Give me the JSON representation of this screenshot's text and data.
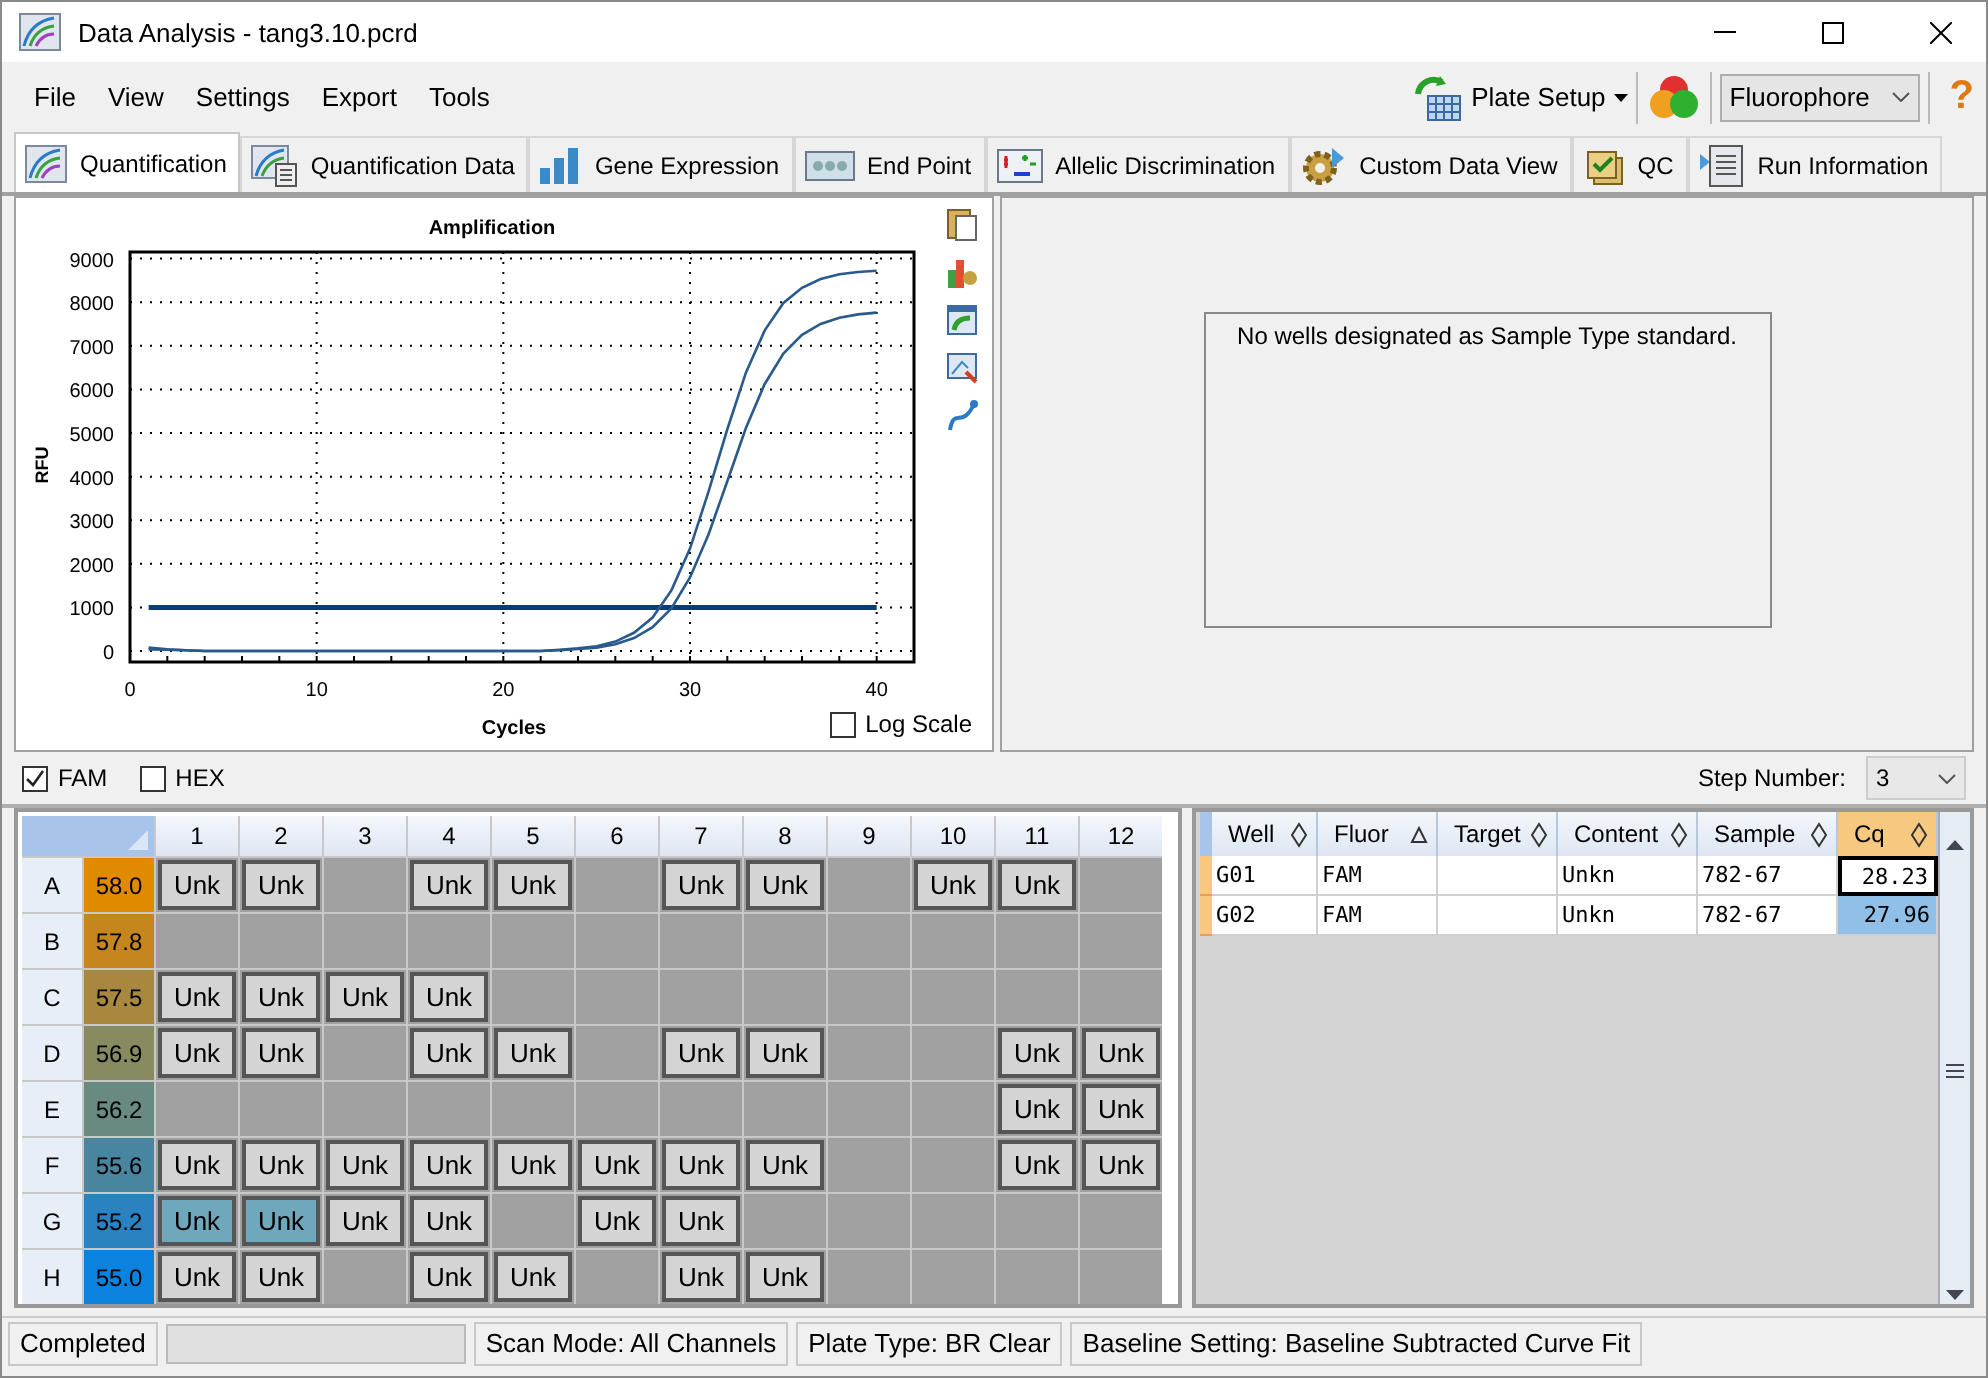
{
  "window": {
    "title": "Data Analysis - tang3.10.pcrd"
  },
  "menu": [
    "File",
    "View",
    "Settings",
    "Export",
    "Tools"
  ],
  "toolbar": {
    "plate_setup": "Plate Setup",
    "view_by": "Fluorophore",
    "help": "?"
  },
  "tabs": [
    {
      "label": "Quantification",
      "selected": true
    },
    {
      "label": "Quantification Data",
      "selected": false
    },
    {
      "label": "Gene Expression",
      "selected": false
    },
    {
      "label": "End Point",
      "selected": false
    },
    {
      "label": "Allelic Discrimination",
      "selected": false
    },
    {
      "label": "Custom Data View",
      "selected": false
    },
    {
      "label": "QC",
      "selected": false
    },
    {
      "label": "Run Information",
      "selected": false
    }
  ],
  "amplification": {
    "log_scale": {
      "label": "Log Scale",
      "checked": false
    },
    "chart_data": {
      "type": "line",
      "title": "Amplification",
      "xlabel": "Cycles",
      "ylabel": "RFU",
      "grid": true,
      "x": [
        1,
        2,
        3,
        4,
        5,
        6,
        7,
        8,
        9,
        10,
        11,
        12,
        13,
        14,
        15,
        16,
        17,
        18,
        19,
        20,
        21,
        22,
        23,
        24,
        25,
        26,
        27,
        28,
        29,
        30,
        31,
        32,
        33,
        34,
        35,
        36,
        37,
        38,
        39,
        40
      ],
      "series": [
        {
          "color": "#2a5a8c",
          "values": [
            80,
            40,
            20,
            0,
            0,
            0,
            0,
            0,
            0,
            0,
            0,
            0,
            0,
            0,
            0,
            0,
            0,
            0,
            0,
            0,
            0,
            0,
            30,
            60,
            110,
            220,
            420,
            770,
            1390,
            2350,
            3660,
            5090,
            6390,
            7350,
            7980,
            8330,
            8530,
            8640,
            8690,
            8720
          ]
        },
        {
          "color": "#2a5a8c",
          "values": [
            40,
            30,
            20,
            0,
            0,
            0,
            0,
            0,
            0,
            0,
            0,
            0,
            0,
            0,
            0,
            0,
            0,
            0,
            0,
            0,
            0,
            0,
            20,
            50,
            80,
            160,
            300,
            550,
            980,
            1690,
            2680,
            3900,
            5120,
            6120,
            6820,
            7250,
            7500,
            7640,
            7720,
            7760
          ]
        }
      ],
      "xlim": [
        0,
        42
      ],
      "ylim": [
        -250,
        9150
      ],
      "xticks": [
        0,
        10,
        20,
        30,
        40
      ],
      "yticks": [
        0,
        1000,
        2000,
        3000,
        4000,
        5000,
        6000,
        7000,
        8000,
        9000
      ],
      "ref_lines": [
        {
          "axis": "y",
          "value": 1000,
          "color": "#0b3c78"
        }
      ]
    }
  },
  "standard_curve": {
    "message": "No wells designated as Sample Type standard."
  },
  "channels": [
    {
      "label": "FAM",
      "checked": true
    },
    {
      "label": "HEX",
      "checked": false
    }
  ],
  "step_number": {
    "label": "Step Number:",
    "value": "3"
  },
  "plate": {
    "columns": [
      "1",
      "2",
      "3",
      "4",
      "5",
      "6",
      "7",
      "8",
      "9",
      "10",
      "11",
      "12"
    ],
    "rows": [
      {
        "label": "A",
        "temp": "58.0",
        "color": "#e08a00",
        "wells": [
          {
            "kind": "sample",
            "text": "Unk",
            "selected": false
          },
          {
            "kind": "sample",
            "text": "Unk",
            "selected": false
          },
          {
            "kind": "empty"
          },
          {
            "kind": "sample",
            "text": "Unk",
            "selected": false
          },
          {
            "kind": "sample",
            "text": "Unk",
            "selected": false
          },
          {
            "kind": "empty"
          },
          {
            "kind": "sample",
            "text": "Unk",
            "selected": false
          },
          {
            "kind": "sample",
            "text": "Unk",
            "selected": false
          },
          {
            "kind": "empty"
          },
          {
            "kind": "sample",
            "text": "Unk",
            "selected": false
          },
          {
            "kind": "sample",
            "text": "Unk",
            "selected": false
          },
          {
            "kind": "empty"
          }
        ]
      },
      {
        "label": "B",
        "temp": "57.8",
        "color": "#c6861e",
        "wells": [
          {
            "kind": "empty"
          },
          {
            "kind": "empty"
          },
          {
            "kind": "empty"
          },
          {
            "kind": "empty"
          },
          {
            "kind": "empty"
          },
          {
            "kind": "empty"
          },
          {
            "kind": "empty"
          },
          {
            "kind": "empty"
          },
          {
            "kind": "empty"
          },
          {
            "kind": "empty"
          },
          {
            "kind": "empty"
          },
          {
            "kind": "empty"
          }
        ]
      },
      {
        "label": "C",
        "temp": "57.5",
        "color": "#a8883e",
        "wells": [
          {
            "kind": "sample",
            "text": "Unk",
            "selected": false
          },
          {
            "kind": "sample",
            "text": "Unk",
            "selected": false
          },
          {
            "kind": "sample",
            "text": "Unk",
            "selected": false
          },
          {
            "kind": "sample",
            "text": "Unk",
            "selected": false
          },
          {
            "kind": "empty"
          },
          {
            "kind": "empty"
          },
          {
            "kind": "empty"
          },
          {
            "kind": "empty"
          },
          {
            "kind": "empty"
          },
          {
            "kind": "empty"
          },
          {
            "kind": "empty"
          },
          {
            "kind": "empty"
          }
        ]
      },
      {
        "label": "D",
        "temp": "56.9",
        "color": "#888a60",
        "wells": [
          {
            "kind": "sample",
            "text": "Unk",
            "selected": false
          },
          {
            "kind": "sample",
            "text": "Unk",
            "selected": false
          },
          {
            "kind": "empty"
          },
          {
            "kind": "sample",
            "text": "Unk",
            "selected": false
          },
          {
            "kind": "sample",
            "text": "Unk",
            "selected": false
          },
          {
            "kind": "empty"
          },
          {
            "kind": "sample",
            "text": "Unk",
            "selected": false
          },
          {
            "kind": "sample",
            "text": "Unk",
            "selected": false
          },
          {
            "kind": "empty"
          },
          {
            "kind": "empty"
          },
          {
            "kind": "sample",
            "text": "Unk",
            "selected": false
          },
          {
            "kind": "sample",
            "text": "Unk",
            "selected": false
          }
        ]
      },
      {
        "label": "E",
        "temp": "56.2",
        "color": "#688a80",
        "wells": [
          {
            "kind": "empty"
          },
          {
            "kind": "empty"
          },
          {
            "kind": "empty"
          },
          {
            "kind": "empty"
          },
          {
            "kind": "empty"
          },
          {
            "kind": "empty"
          },
          {
            "kind": "empty"
          },
          {
            "kind": "empty"
          },
          {
            "kind": "empty"
          },
          {
            "kind": "empty"
          },
          {
            "kind": "sample",
            "text": "Unk",
            "selected": false
          },
          {
            "kind": "sample",
            "text": "Unk",
            "selected": false
          }
        ]
      },
      {
        "label": "F",
        "temp": "55.6",
        "color": "#4886a0",
        "wells": [
          {
            "kind": "sample",
            "text": "Unk",
            "selected": false
          },
          {
            "kind": "sample",
            "text": "Unk",
            "selected": false
          },
          {
            "kind": "sample",
            "text": "Unk",
            "selected": false
          },
          {
            "kind": "sample",
            "text": "Unk",
            "selected": false
          },
          {
            "kind": "sample",
            "text": "Unk",
            "selected": false
          },
          {
            "kind": "sample",
            "text": "Unk",
            "selected": false
          },
          {
            "kind": "sample",
            "text": "Unk",
            "selected": false
          },
          {
            "kind": "sample",
            "text": "Unk",
            "selected": false
          },
          {
            "kind": "empty"
          },
          {
            "kind": "empty"
          },
          {
            "kind": "sample",
            "text": "Unk",
            "selected": false
          },
          {
            "kind": "sample",
            "text": "Unk",
            "selected": false
          }
        ]
      },
      {
        "label": "G",
        "temp": "55.2",
        "color": "#2a82c0",
        "wells": [
          {
            "kind": "sample",
            "text": "Unk",
            "selected": true
          },
          {
            "kind": "sample",
            "text": "Unk",
            "selected": true
          },
          {
            "kind": "sample",
            "text": "Unk",
            "selected": false
          },
          {
            "kind": "sample",
            "text": "Unk",
            "selected": false
          },
          {
            "kind": "empty"
          },
          {
            "kind": "sample",
            "text": "Unk",
            "selected": false
          },
          {
            "kind": "sample",
            "text": "Unk",
            "selected": false
          },
          {
            "kind": "empty"
          },
          {
            "kind": "empty"
          },
          {
            "kind": "empty"
          },
          {
            "kind": "empty"
          },
          {
            "kind": "empty"
          }
        ]
      },
      {
        "label": "H",
        "temp": "55.0",
        "color": "#0a82de",
        "wells": [
          {
            "kind": "sample",
            "text": "Unk",
            "selected": false
          },
          {
            "kind": "sample",
            "text": "Unk",
            "selected": false
          },
          {
            "kind": "empty"
          },
          {
            "kind": "sample",
            "text": "Unk",
            "selected": false
          },
          {
            "kind": "sample",
            "text": "Unk",
            "selected": false
          },
          {
            "kind": "empty"
          },
          {
            "kind": "sample",
            "text": "Unk",
            "selected": false
          },
          {
            "kind": "sample",
            "text": "Unk",
            "selected": false
          },
          {
            "kind": "empty"
          },
          {
            "kind": "empty"
          },
          {
            "kind": "empty"
          },
          {
            "kind": "empty"
          }
        ]
      }
    ]
  },
  "results": {
    "columns": [
      {
        "label": "Well",
        "sorted": false,
        "selected": false
      },
      {
        "label": "Fluor",
        "sorted": true,
        "selected": false
      },
      {
        "label": "Target",
        "sorted": false,
        "selected": false
      },
      {
        "label": "Content",
        "sorted": false,
        "selected": false
      },
      {
        "label": "Sample",
        "sorted": false,
        "selected": false
      },
      {
        "label": "Cq",
        "sorted": false,
        "selected": true
      }
    ],
    "rows": [
      {
        "well": "G01",
        "fluor": "FAM",
        "content": "Unkn",
        "sample": "782-67",
        "cq": "28.23",
        "current": true,
        "selected": false
      },
      {
        "well": "G02",
        "fluor": "FAM",
        "content": "Unkn",
        "sample": "782-67",
        "cq": "27.96",
        "current": false,
        "selected": true
      }
    ]
  },
  "status_bar": {
    "state": "Completed",
    "scan_mode": "Scan Mode: All Channels",
    "plate_type": "Plate Type: BR Clear",
    "baseline": "Baseline Setting: Baseline Subtracted Curve Fit"
  }
}
